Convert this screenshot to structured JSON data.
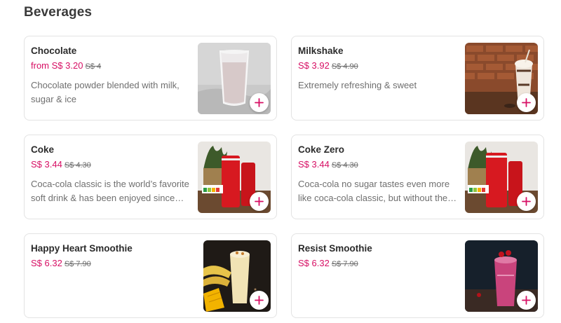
{
  "section": {
    "title": "Beverages"
  },
  "items": [
    {
      "name": "Chocolate",
      "price_prefix": "from ",
      "price": "S$ 3.20",
      "old_price": "S$ 4",
      "description": "Chocolate powder blended with milk, sugar & ice"
    },
    {
      "name": "Milkshake",
      "price_prefix": "",
      "price": "S$ 3.92",
      "old_price": "S$ 4.90",
      "description": "Extremely refreshing & sweet"
    },
    {
      "name": "Coke",
      "price_prefix": "",
      "price": "S$ 3.44",
      "old_price": "S$ 4.30",
      "description": "Coca-cola classic is the world’s favorite soft drink & has been enjoyed since…"
    },
    {
      "name": "Coke Zero",
      "price_prefix": "",
      "price": "S$ 3.44",
      "old_price": "S$ 4.30",
      "description": "Coca-cola no sugar tastes even more like coca-cola classic, but without the…"
    },
    {
      "name": "Happy Heart Smoothie",
      "price_prefix": "",
      "price": "S$ 6.32",
      "old_price": "S$ 7.90",
      "description": ""
    },
    {
      "name": "Resist Smoothie",
      "price_prefix": "",
      "price": "S$ 6.32",
      "old_price": "S$ 7.90",
      "description": ""
    }
  ],
  "icons": {
    "add": "plus-icon"
  },
  "colors": {
    "accent": "#d70f64",
    "text": "#2b2b2b",
    "muted": "#6f6f6f",
    "border": "#e3e3e3"
  }
}
